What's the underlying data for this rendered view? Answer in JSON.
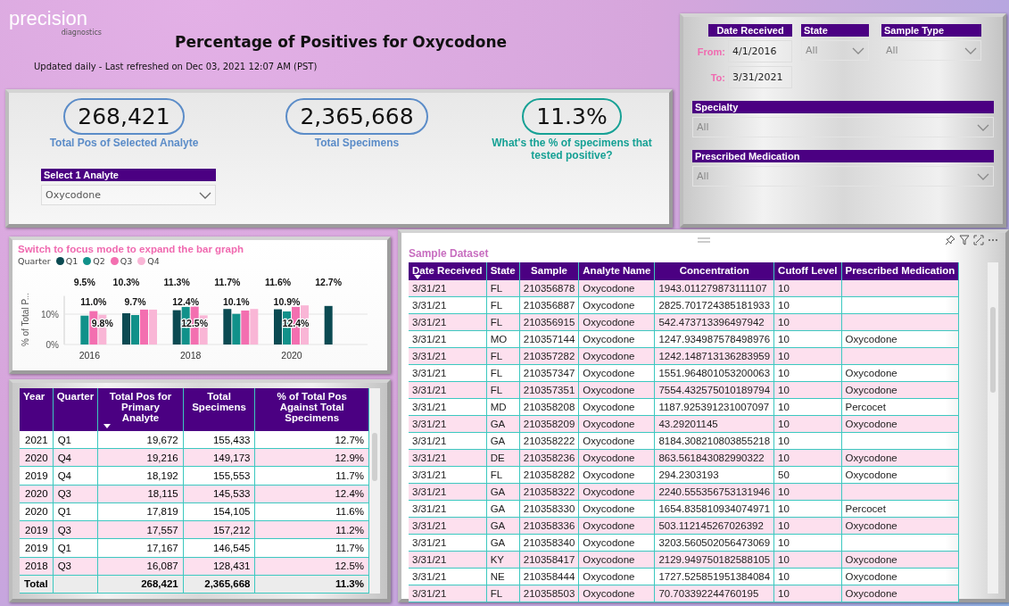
{
  "logo": {
    "name": "precision",
    "sub": "diagnostics"
  },
  "title": "Percentage of Positives for Oxycodone",
  "refreshed": "Updated daily - Last refreshed on Dec 03, 2021 12:07 AM (PST)",
  "kpis": [
    {
      "value": "268,421",
      "label": "Total Pos of Selected Analyte",
      "color": "#5b8cc8"
    },
    {
      "value": "2,365,668",
      "label": "Total Specimens",
      "color": "#5b8cc8"
    },
    {
      "value": "11.3%",
      "label": "What's the % of specimens that tested positive?",
      "color": "#17a195"
    }
  ],
  "analyte_slicer": {
    "label": "Select 1 Analyte",
    "value": "Oxycodone"
  },
  "filters": {
    "date_received": {
      "label": "Date Received",
      "from_label": "From:",
      "from": "4/1/2016",
      "to_label": "To:",
      "to": "3/31/2021"
    },
    "state": {
      "label": "State",
      "value": "All"
    },
    "sample_type": {
      "label": "Sample Type",
      "value": "All"
    },
    "specialty": {
      "label": "Specialty",
      "value": "All"
    },
    "prescribed_medication": {
      "label": "Prescribed Medication",
      "value": "All"
    }
  },
  "chart": {
    "title": "Switch to focus mode to expand the bar graph",
    "legend_title": "Quarter",
    "chart_data": {
      "type": "bar",
      "ylabel": "% of Total P...",
      "categories": [
        "2016",
        null,
        "2018",
        null,
        "2020",
        null
      ],
      "yticks": [
        {
          "value": 0,
          "label": "0%"
        },
        {
          "value": 10,
          "label": "10%"
        }
      ],
      "ylim": [
        0,
        16
      ],
      "series": [
        {
          "name": "Q1",
          "color": "#0b4a52",
          "values": [
            null,
            10.3,
            11.3,
            11.7,
            11.6,
            12.7
          ],
          "value_labels": [
            null,
            "10.3%",
            "11.3%",
            "11.7%",
            "11.6%",
            "12.7%"
          ]
        },
        {
          "name": "Q2",
          "color": "#11918a",
          "values": [
            9.5,
            9.7,
            12.4,
            10.1,
            10.9,
            null
          ],
          "value_labels": [
            "9.5%",
            "9.7%",
            "12.4%",
            "10.1%",
            "10.9%",
            null
          ]
        },
        {
          "name": "Q3",
          "color": "#f36fb0",
          "values": [
            11.0,
            11.5,
            12.5,
            11.2,
            12.4,
            null
          ],
          "value_labels": [
            "11.0%",
            null,
            "12.5%",
            null,
            "12.4%",
            null
          ]
        },
        {
          "name": "Q4",
          "color": "#f9b6d6",
          "values": [
            9.8,
            11.5,
            9.6,
            11.7,
            12.9,
            null
          ],
          "value_labels": [
            "9.8%",
            null,
            null,
            null,
            null,
            null
          ]
        }
      ]
    }
  },
  "quarter_table": {
    "columns": [
      {
        "label": "Year",
        "sorted": false
      },
      {
        "label": "Quarter",
        "sorted": false
      },
      {
        "label": "Total Pos for Primary Analyte",
        "sorted": true
      },
      {
        "label": "Total Specimens",
        "sorted": false
      },
      {
        "label": "% of Total Pos Against Total Specimens",
        "sorted": false
      }
    ],
    "rows": [
      [
        "2021",
        "Q1",
        "19,672",
        "155,433",
        "12.7%"
      ],
      [
        "2020",
        "Q4",
        "19,216",
        "149,173",
        "12.9%"
      ],
      [
        "2019",
        "Q4",
        "18,192",
        "155,553",
        "11.7%"
      ],
      [
        "2020",
        "Q3",
        "18,115",
        "145,533",
        "12.4%"
      ],
      [
        "2020",
        "Q1",
        "17,819",
        "154,105",
        "11.6%"
      ],
      [
        "2019",
        "Q3",
        "17,557",
        "157,212",
        "11.2%"
      ],
      [
        "2019",
        "Q1",
        "17,167",
        "146,545",
        "11.7%"
      ],
      [
        "2018",
        "Q3",
        "16,087",
        "128,431",
        "12.5%"
      ]
    ],
    "total": {
      "label": "Total",
      "values": [
        "268,421",
        "2,365,668",
        "11.3%"
      ]
    }
  },
  "dataset": {
    "title": "Sample Dataset",
    "columns": [
      {
        "label": "Date Received",
        "sorted": true
      },
      {
        "label": "State",
        "sorted": false
      },
      {
        "label": "Sample",
        "sorted": false
      },
      {
        "label": "Analyte Name",
        "sorted": false
      },
      {
        "label": "Concentration",
        "sorted": false
      },
      {
        "label": "Cutoff Level",
        "sorted": false
      },
      {
        "label": "Prescribed Medication",
        "sorted": false
      }
    ],
    "rows": [
      [
        "3/31/21",
        "FL",
        "210356878",
        "Oxycodone",
        "1943.011279873111107",
        "10",
        ""
      ],
      [
        "3/31/21",
        "FL",
        "210356887",
        "Oxycodone",
        "2825.701724385181933",
        "10",
        ""
      ],
      [
        "3/31/21",
        "FL",
        "210356915",
        "Oxycodone",
        "542.473713396497942",
        "10",
        ""
      ],
      [
        "3/31/21",
        "MO",
        "210357144",
        "Oxycodone",
        "1247.934987578498976",
        "10",
        "Oxycodone"
      ],
      [
        "3/31/21",
        "FL",
        "210357282",
        "Oxycodone",
        "1242.148713136283959",
        "10",
        ""
      ],
      [
        "3/31/21",
        "FL",
        "210357347",
        "Oxycodone",
        "1551.964801053200063",
        "10",
        "Oxycodone"
      ],
      [
        "3/31/21",
        "FL",
        "210357351",
        "Oxycodone",
        "7554.432575010189794",
        "10",
        "Oxycodone"
      ],
      [
        "3/31/21",
        "MD",
        "210358208",
        "Oxycodone",
        "1187.925391231007097",
        "10",
        "Percocet"
      ],
      [
        "3/31/21",
        "GA",
        "210358209",
        "Oxycodone",
        "43.29201145",
        "10",
        "Oxycodone"
      ],
      [
        "3/31/21",
        "GA",
        "210358222",
        "Oxycodone",
        "8184.308210803855218",
        "10",
        ""
      ],
      [
        "3/31/21",
        "DE",
        "210358236",
        "Oxycodone",
        "863.561843082990322",
        "10",
        "Oxycodone"
      ],
      [
        "3/31/21",
        "FL",
        "210358282",
        "Oxycodone",
        "294.2303193",
        "50",
        "Oxycodone"
      ],
      [
        "3/31/21",
        "GA",
        "210358322",
        "Oxycodone",
        "2240.555356753131946",
        "10",
        ""
      ],
      [
        "3/31/21",
        "GA",
        "210358330",
        "Oxycodone",
        "1654.835810934074971",
        "10",
        "Percocet"
      ],
      [
        "3/31/21",
        "GA",
        "210358336",
        "Oxycodone",
        "503.112145267026392",
        "10",
        "Oxycodone"
      ],
      [
        "3/31/21",
        "GA",
        "210358340",
        "Oxycodone",
        "3203.560502056473069",
        "10",
        ""
      ],
      [
        "3/31/21",
        "KY",
        "210358417",
        "Oxycodone",
        "2129.949750182588105",
        "10",
        "Oxycodone"
      ],
      [
        "3/31/21",
        "NE",
        "210358444",
        "Oxycodone",
        "1727.525851951384084",
        "10",
        "Oxycodone"
      ],
      [
        "3/31/21",
        "FL",
        "210358503",
        "Oxycodone",
        "70.703392244760195",
        "10",
        "Oxycodone"
      ]
    ]
  }
}
